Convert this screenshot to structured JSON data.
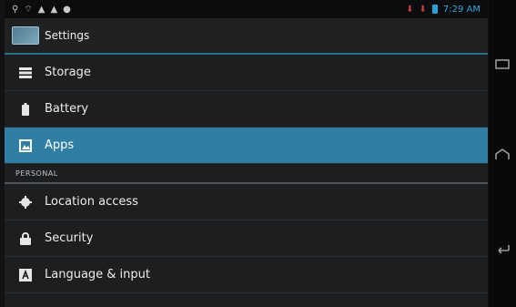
{
  "status": {
    "time": "7:29 AM",
    "icons_left": [
      "usb-icon",
      "wifi-icon",
      "alert-icon",
      "alert-icon",
      "android-icon"
    ],
    "icons_right": [
      "notification-icon",
      "notification-icon",
      "battery-icon"
    ]
  },
  "header": {
    "title": "Settings"
  },
  "list": {
    "items": [
      {
        "label": "Storage",
        "icon": "storage-icon",
        "active": false
      },
      {
        "label": "Battery",
        "icon": "battery-icon",
        "active": false
      },
      {
        "label": "Apps",
        "icon": "apps-icon",
        "active": true
      }
    ],
    "section_header": "PERSONAL",
    "personal": [
      {
        "label": "Location access",
        "icon": "location-icon"
      },
      {
        "label": "Security",
        "icon": "lock-icon"
      },
      {
        "label": "Language & input",
        "icon": "language-icon"
      }
    ]
  },
  "colors": {
    "accent": "#2f7fa5",
    "status_time": "#32a6dc",
    "background": "#1c1e20"
  }
}
